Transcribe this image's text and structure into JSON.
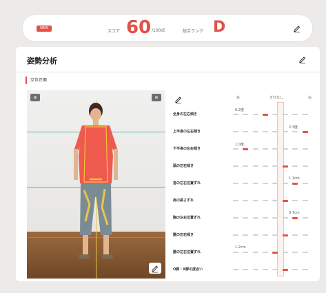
{
  "header": {
    "badge": "NEW",
    "score_label": "スコア",
    "score_value": "60",
    "score_max": "/100点",
    "rank_label": "総合ランク",
    "rank_value": "D"
  },
  "section": {
    "title": "姿勢分析",
    "subsection": "立位正面"
  },
  "photo_buttons": {
    "left": "⊕",
    "right": "⊕"
  },
  "table": {
    "col_left": "左",
    "col_center": "ずれなし",
    "col_right": "右",
    "rows": [
      {
        "label": "全身の左右傾き",
        "value": "0.2度",
        "active_index": 3
      },
      {
        "label": "上半身の左右傾き",
        "value": "2.3度",
        "active_index": 7
      },
      {
        "label": "下半身の左右傾き",
        "value": "1.0度",
        "active_index": 1
      },
      {
        "label": "頭の左右傾き",
        "value": "",
        "active_index": 5
      },
      {
        "label": "首の左右位置ずれ",
        "value": "1.1cm",
        "active_index": 6
      },
      {
        "label": "肩の高さずれ",
        "value": "",
        "active_index": 5
      },
      {
        "label": "胸の左右位置ずれ",
        "value": "0.7cm",
        "active_index": 6
      },
      {
        "label": "腰の左右傾き",
        "value": "",
        "active_index": 5
      },
      {
        "label": "腰の左右位置ずれ",
        "value": "1.2cm",
        "active_index": 4
      },
      {
        "label": "O脚・X脚の度合い",
        "value": "",
        "active_index": 5
      }
    ]
  },
  "colors": {
    "accent": "#e0524a",
    "grid": "#4aa7a2",
    "center": "#e8c53a"
  }
}
